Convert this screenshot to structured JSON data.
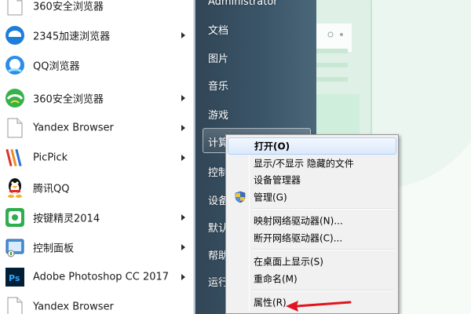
{
  "programs": [
    {
      "label": "360安全浏览器",
      "icon": "360-browser-icon",
      "submenu": false
    },
    {
      "label": "2345加速浏览器",
      "icon": "2345-browser-icon",
      "submenu": true
    },
    {
      "label": "QQ浏览器",
      "icon": "qq-browser-icon",
      "submenu": false
    },
    {
      "label": "360安全浏览器",
      "icon": "360-browser-icon",
      "submenu": true
    },
    {
      "label": "Yandex Browser",
      "icon": "file-icon",
      "submenu": true
    },
    {
      "label": "PicPick",
      "icon": "picpick-icon",
      "submenu": true
    },
    {
      "label": "腾讯QQ",
      "icon": "qq-penguin-icon",
      "submenu": false
    },
    {
      "label": "按键精灵2014",
      "icon": "anjian-icon",
      "submenu": true
    },
    {
      "label": "控制面板",
      "icon": "control-panel-icon",
      "submenu": true
    },
    {
      "label": "Adobe Photoshop CC 2017",
      "icon": "photoshop-icon",
      "submenu": true
    },
    {
      "label": "Yandex Browser",
      "icon": "file-icon",
      "submenu": false
    }
  ],
  "right_menu": {
    "user": "Administrator",
    "documents": "文档",
    "pictures": "图片",
    "music": "音乐",
    "games": "游戏",
    "computer": "计算机",
    "control_panel": "控制",
    "devices": "设备",
    "default_programs": "默认",
    "help": "帮助",
    "run": "运行"
  },
  "context_menu": {
    "open": "打开(O)",
    "show_hide": "显示/不显示 隐藏的文件",
    "device_manager": "设备管理器",
    "manage": "管理(G)",
    "map_drive": "映射网络驱动器(N)...",
    "disconnect_drive": "断开网络驱动器(C)...",
    "show_desktop": "在桌面上显示(S)",
    "rename": "重命名(M)",
    "properties": "属性(R)"
  },
  "colors": {
    "right_column": "#3b5568",
    "menu_bg": "#f1f1f1",
    "highlight": "#dbe9fb",
    "arrow": "#e0141e"
  }
}
